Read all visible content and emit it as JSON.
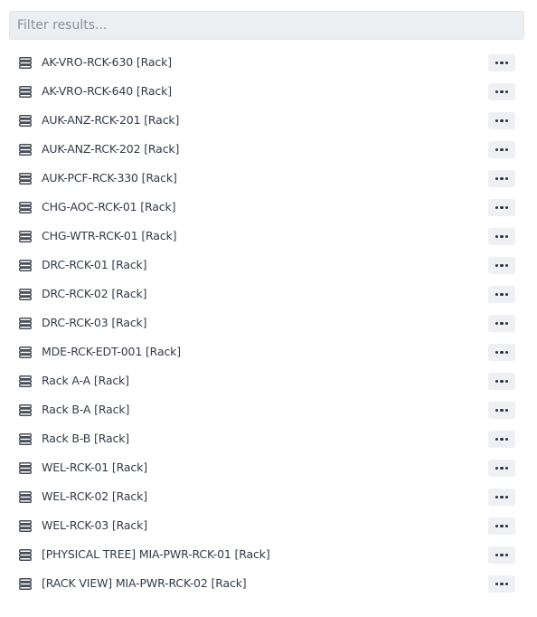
{
  "filter": {
    "placeholder": "Filter results...",
    "value": ""
  },
  "items": [
    {
      "label": "AK-VRO-RCK-630 [Rack]"
    },
    {
      "label": "AK-VRO-RCK-640 [Rack]"
    },
    {
      "label": "AUK-ANZ-RCK-201 [Rack]"
    },
    {
      "label": "AUK-ANZ-RCK-202 [Rack]"
    },
    {
      "label": "AUK-PCF-RCK-330 [Rack]"
    },
    {
      "label": "CHG-AOC-RCK-01 [Rack]"
    },
    {
      "label": "CHG-WTR-RCK-01 [Rack]"
    },
    {
      "label": "DRC-RCK-01 [Rack]"
    },
    {
      "label": "DRC-RCK-02 [Rack]"
    },
    {
      "label": "DRC-RCK-03 [Rack]"
    },
    {
      "label": "MDE-RCK-EDT-001 [Rack]"
    },
    {
      "label": "Rack A-A [Rack]"
    },
    {
      "label": "Rack B-A [Rack]"
    },
    {
      "label": "Rack B-B [Rack]"
    },
    {
      "label": "WEL-RCK-01 [Rack]"
    },
    {
      "label": "WEL-RCK-02 [Rack]"
    },
    {
      "label": "WEL-RCK-03 [Rack]"
    },
    {
      "label": "[PHYSICAL TREE] MIA-PWR-RCK-01 [Rack]"
    },
    {
      "label": "[RACK VIEW] MIA-PWR-RCK-02 [Rack]"
    }
  ],
  "icons": {
    "item_icon": "rack-icon",
    "action_icon": "more-horizontal-icon"
  }
}
